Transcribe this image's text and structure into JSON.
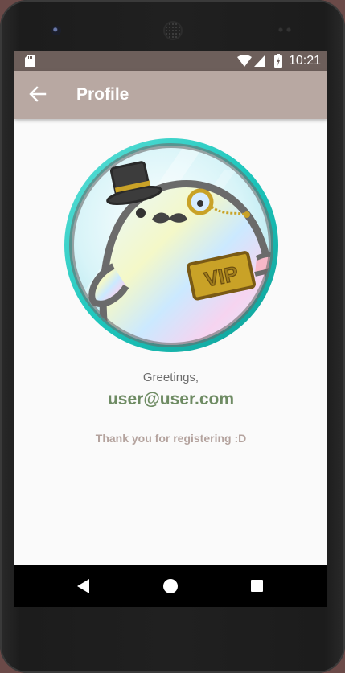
{
  "status_bar": {
    "time": "10:21",
    "icons": [
      "sd-card-icon",
      "wifi-icon",
      "signal-icon",
      "battery-icon"
    ]
  },
  "app_bar": {
    "title": "Profile",
    "back_icon": "arrow-left-icon",
    "color": "#b8a8a2"
  },
  "profile": {
    "avatar": "penguin-vip-avatar",
    "greeting": "Greetings,",
    "email": "user@user.com",
    "message": "Thank you for registering :D",
    "badge_text": "VIP"
  },
  "nav_bar": {
    "back": "nav-back-icon",
    "home": "nav-home-icon",
    "recents": "nav-recents-icon"
  },
  "colors": {
    "status_bar": "#6d5f5b",
    "email": "#6e8b63",
    "message": "#b4a39e"
  }
}
